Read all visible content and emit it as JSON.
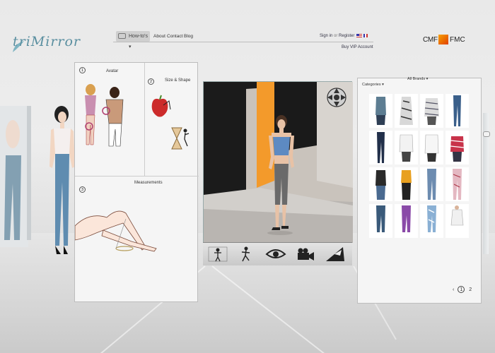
{
  "brand": {
    "logo_text": "triMirror"
  },
  "nav": {
    "howtos_label": "How-to's",
    "about_label": "About",
    "contact_label": "Contact",
    "blog_label": "Blog",
    "signin_label": "Sign in",
    "or_label": "or",
    "register_label": "Register",
    "vip_label": "Buy VIP Account"
  },
  "partner": {
    "left": "CMF",
    "right": "FMC"
  },
  "left_panel": {
    "cells": [
      {
        "number": "1",
        "title": "Avatar"
      },
      {
        "number": "2",
        "title": "Size & Shape"
      },
      {
        "number": "3",
        "title": "Measurements"
      }
    ]
  },
  "right_panel": {
    "category_label": "Categories",
    "brand_label": "All Brands",
    "pager": {
      "prev": "‹",
      "pages": [
        "1",
        "2"
      ],
      "current": "1"
    }
  },
  "toolbar": {
    "tools": [
      "pose-icon",
      "walk-icon",
      "eye-icon",
      "camera-icon",
      "lighting-icon"
    ]
  },
  "colors": {
    "accent_blue": "#5a8fa0",
    "runway_orange": "#f39a2b",
    "panel_bg": "#f5f5f5"
  }
}
